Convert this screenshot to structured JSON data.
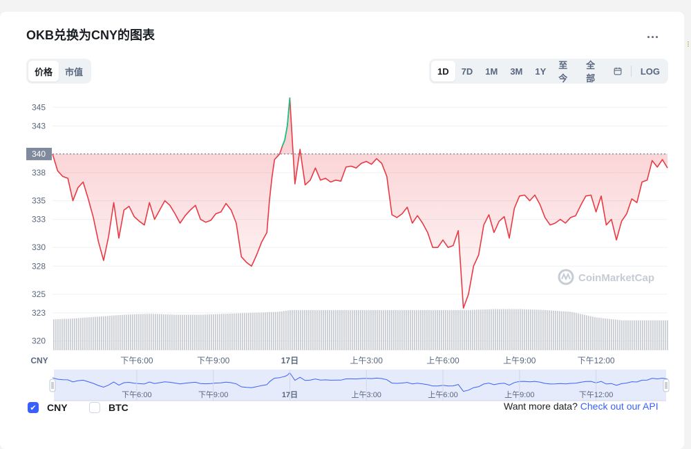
{
  "header": {
    "title": "OKB兑换为CNY的图表",
    "more_label": "...",
    "edge_glyph": "⁝"
  },
  "toggles": {
    "price": "价格",
    "market_cap": "市值"
  },
  "ranges": [
    "1D",
    "7D",
    "1M",
    "3M",
    "1Y",
    "至今",
    "全部"
  ],
  "log_label": "LOG",
  "chart_data": {
    "type": "area",
    "y_ticks": [
      320,
      323,
      325,
      328,
      330,
      333,
      335,
      338,
      340,
      343,
      345
    ],
    "ylim": [
      319.0,
      346.5
    ],
    "current_price_label": "340",
    "current_price": 340.0,
    "x_ticks": [
      "下午6:00",
      "下午9:00",
      "17日",
      "上午3:00",
      "上午6:00",
      "上午9:00",
      "下午12:00"
    ],
    "x_tick_hours": [
      18,
      21,
      24,
      27,
      30,
      33,
      36
    ],
    "x_range_hours": [
      14.7,
      38.8
    ],
    "currency_label": "CNY",
    "series": [
      {
        "x": [
          14.7,
          14.9,
          15.1,
          15.3,
          15.5,
          15.7,
          15.9,
          16.1,
          16.3,
          16.5,
          16.7,
          16.9,
          17.1,
          17.3,
          17.5,
          17.7,
          17.9,
          18.1,
          18.3,
          18.5,
          18.7,
          18.9,
          19.1,
          19.3,
          19.5,
          19.7,
          19.9,
          20.1,
          20.3,
          20.5,
          20.7,
          20.9,
          21.1,
          21.3,
          21.5,
          21.7,
          21.9,
          22.1,
          22.3,
          22.5,
          22.7,
          22.9,
          23.1,
          23.2,
          23.3,
          23.4,
          23.6,
          23.7,
          23.8,
          23.9,
          24.0,
          24.2,
          24.4,
          24.6,
          24.8,
          25.0,
          25.2,
          25.4,
          25.6,
          25.8,
          26.0,
          26.2,
          26.4,
          26.6,
          26.8,
          27.0,
          27.2,
          27.4,
          27.6,
          27.8,
          28.0,
          28.2,
          28.4,
          28.6,
          28.8,
          29.0,
          29.2,
          29.4,
          29.6,
          29.8,
          30.0,
          30.2,
          30.4,
          30.6,
          30.8,
          31.0,
          31.2,
          31.4,
          31.6,
          31.8,
          32.0,
          32.2,
          32.4,
          32.6,
          32.8,
          33.0,
          33.2,
          33.4,
          33.6,
          33.8,
          34.0,
          34.2,
          34.4,
          34.6,
          34.8,
          35.0,
          35.2,
          35.4,
          35.6,
          35.8,
          36.0,
          36.2,
          36.4,
          36.6,
          36.8,
          37.0,
          37.2,
          37.4,
          37.6,
          37.8,
          38.0,
          38.2,
          38.4,
          38.6,
          38.8
        ],
        "y": [
          340.0,
          338.2,
          337.6,
          337.4,
          335.0,
          336.4,
          337.0,
          335.2,
          333.2,
          330.6,
          328.6,
          331.2,
          334.8,
          331.0,
          334.0,
          334.4,
          333.3,
          332.8,
          332.4,
          334.8,
          333.0,
          334.0,
          335.0,
          334.5,
          333.6,
          332.6,
          333.4,
          334.0,
          334.5,
          333.0,
          332.7,
          332.9,
          333.6,
          333.8,
          334.7,
          334.0,
          332.6,
          329.0,
          328.4,
          328.0,
          329.2,
          330.6,
          331.6,
          335.0,
          337.5,
          339.4,
          340.0,
          340.8,
          341.5,
          343.0,
          346.0,
          336.8,
          340.5,
          336.7,
          337.2,
          338.5,
          337.2,
          337.4,
          337.0,
          337.2,
          337.1,
          338.6,
          338.7,
          338.5,
          339.0,
          339.2,
          338.9,
          339.5,
          339.0,
          337.6,
          333.5,
          333.2,
          333.6,
          334.3,
          332.6,
          333.4,
          332.6,
          331.6,
          330.0,
          330.0,
          330.8,
          330.0,
          330.2,
          331.8,
          323.5,
          325.0,
          328.0,
          329.2,
          332.4,
          333.5,
          331.6,
          332.8,
          333.3,
          331.0,
          334.2,
          335.5,
          335.6,
          335.0,
          335.6,
          334.6,
          333.2,
          332.4,
          332.6,
          333.0,
          332.6,
          333.2,
          333.4,
          334.5,
          335.5,
          335.6,
          333.8,
          335.5,
          332.4,
          333.0,
          330.8,
          332.8,
          333.6,
          335.2,
          334.8,
          337.0,
          337.2,
          339.3,
          338.6,
          339.4,
          338.5
        ],
        "color": "#ea3943"
      }
    ],
    "highlight_segment": {
      "color": "#16c784",
      "hours": [
        23.7,
        24.0
      ]
    },
    "volume": {
      "hours": [
        14.7,
        15.5,
        16.5,
        17.5,
        18.5,
        19.5,
        20.5,
        21.5,
        22.5,
        23.5,
        24.0,
        25.0,
        26.0,
        27.0,
        28.0,
        29.0,
        30.0,
        31.0,
        32.0,
        33.0,
        34.0,
        35.0,
        36.0,
        37.0,
        38.0,
        38.8
      ],
      "values": [
        322.3,
        322.4,
        322.6,
        322.8,
        322.9,
        322.8,
        322.8,
        322.9,
        323.0,
        323.1,
        323.3,
        323.3,
        323.3,
        323.3,
        323.3,
        323.3,
        323.3,
        323.3,
        323.4,
        323.4,
        323.3,
        323.1,
        322.5,
        322.2,
        322.2,
        322.2
      ]
    },
    "navigator_ticks": [
      "下午6:00",
      "下午9:00",
      "17日",
      "上午3:00",
      "上午6:00",
      "上午9:00",
      "下午12:00"
    ],
    "watermark": "CoinMarketCap",
    "grid": true,
    "colors": {
      "line": "#ea3943",
      "up": "#16c784",
      "volume": "#c9cdd3",
      "navigator_fill": "#e6ebfc",
      "navigator_line": "#3861fb"
    }
  },
  "legend": {
    "cny": "CNY",
    "btc": "BTC"
  },
  "api": {
    "prefix": "Want more data?",
    "link": "Check out our API"
  }
}
